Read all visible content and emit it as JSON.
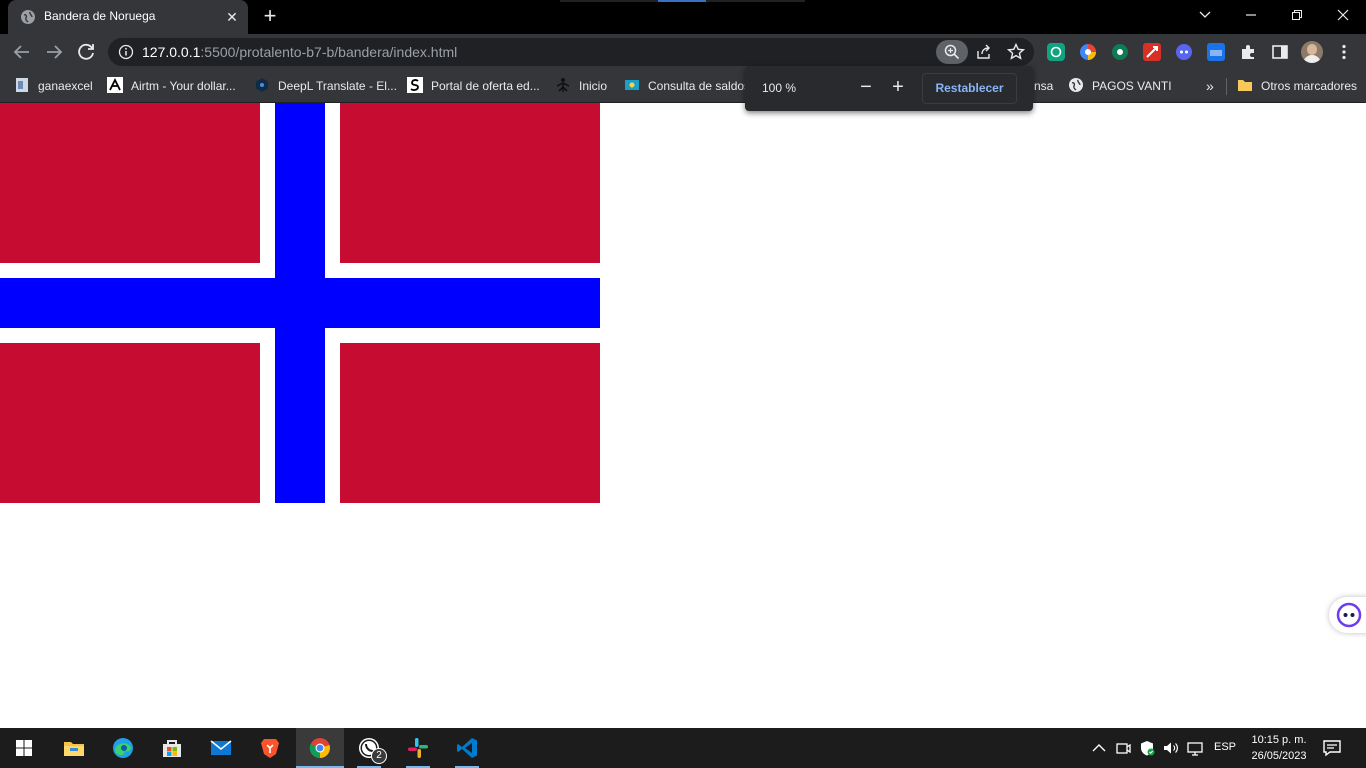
{
  "browser": {
    "tab": {
      "title": "Bandera de Noruega"
    },
    "url": {
      "host": "127.0.0.1",
      "path": ":5500/protalento-b7-b/bandera/index.html"
    },
    "zoom_popup": {
      "level": "100 %",
      "minus": "−",
      "plus": "+",
      "reset_label": "Restablecer"
    },
    "bookmarks": [
      {
        "label": "ganaexcel",
        "icon": "document-icon"
      },
      {
        "label": "Airtm - Your dollar...",
        "icon": "airtm-icon"
      },
      {
        "label": "DeepL Translate - El...",
        "icon": "deepl-icon"
      },
      {
        "label": "Portal de oferta ed...",
        "icon": "portal-icon"
      },
      {
        "label": "Inicio",
        "icon": "sena-icon"
      },
      {
        "label": "Consulta de saldos",
        "icon": "saldos-icon"
      },
      {
        "label": "nsa",
        "icon": ""
      },
      {
        "label": "PAGOS VANTI",
        "icon": "globe-icon"
      }
    ],
    "bookmarks_overflow": "»",
    "other_bookmarks": "Otros marcadores"
  },
  "flag": {
    "colors": {
      "red": "#c60c30",
      "white": "#ffffff",
      "blue": "#0000ff"
    }
  },
  "taskbar": {
    "apps": [
      {
        "name": "file-explorer-icon"
      },
      {
        "name": "edge-icon"
      },
      {
        "name": "store-icon"
      },
      {
        "name": "mail-icon"
      },
      {
        "name": "brave-icon"
      },
      {
        "name": "chrome-icon",
        "active": true
      },
      {
        "name": "whatsapp-icon",
        "badge": "2"
      },
      {
        "name": "slack-icon"
      },
      {
        "name": "vscode-icon"
      }
    ],
    "language": "ESP",
    "time": "10:15 p. m.",
    "date": "26/05/2023"
  }
}
